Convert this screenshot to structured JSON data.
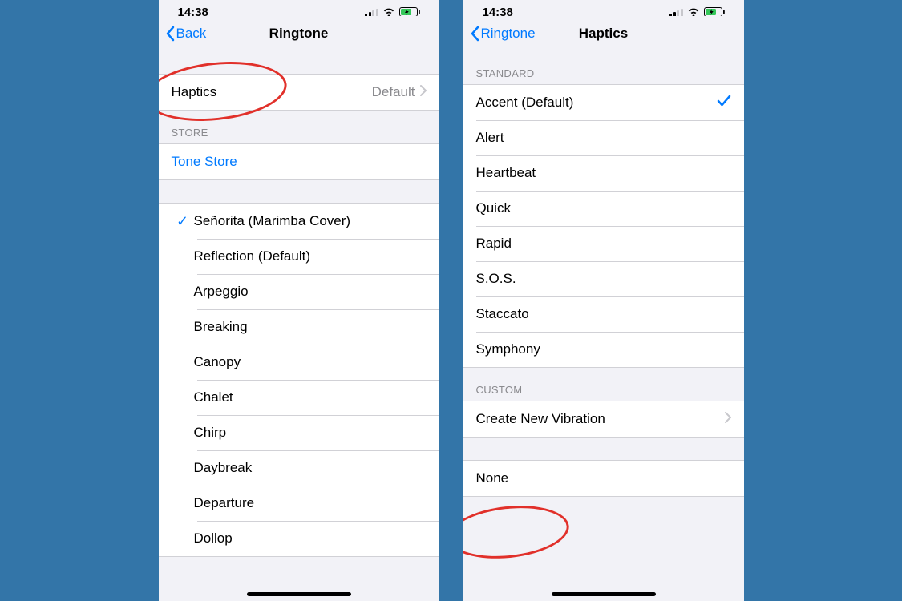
{
  "status": {
    "time": "14:38"
  },
  "left": {
    "back": "Back",
    "title": "Ringtone",
    "haptics": {
      "label": "Haptics",
      "value": "Default"
    },
    "store_header": "STORE",
    "store_link": "Tone Store",
    "ringtones": {
      "selected": "Señorita (Marimba Cover)",
      "items": [
        "Reflection (Default)",
        "Arpeggio",
        "Breaking",
        "Canopy",
        "Chalet",
        "Chirp",
        "Daybreak",
        "Departure",
        "Dollop"
      ]
    }
  },
  "right": {
    "back": "Ringtone",
    "title": "Haptics",
    "standard_header": "STANDARD",
    "standard": {
      "selected": "Accent (Default)",
      "items": [
        "Alert",
        "Heartbeat",
        "Quick",
        "Rapid",
        "S.O.S.",
        "Staccato",
        "Symphony"
      ]
    },
    "custom_header": "CUSTOM",
    "custom_label": "Create New Vibration",
    "none_label": "None"
  }
}
